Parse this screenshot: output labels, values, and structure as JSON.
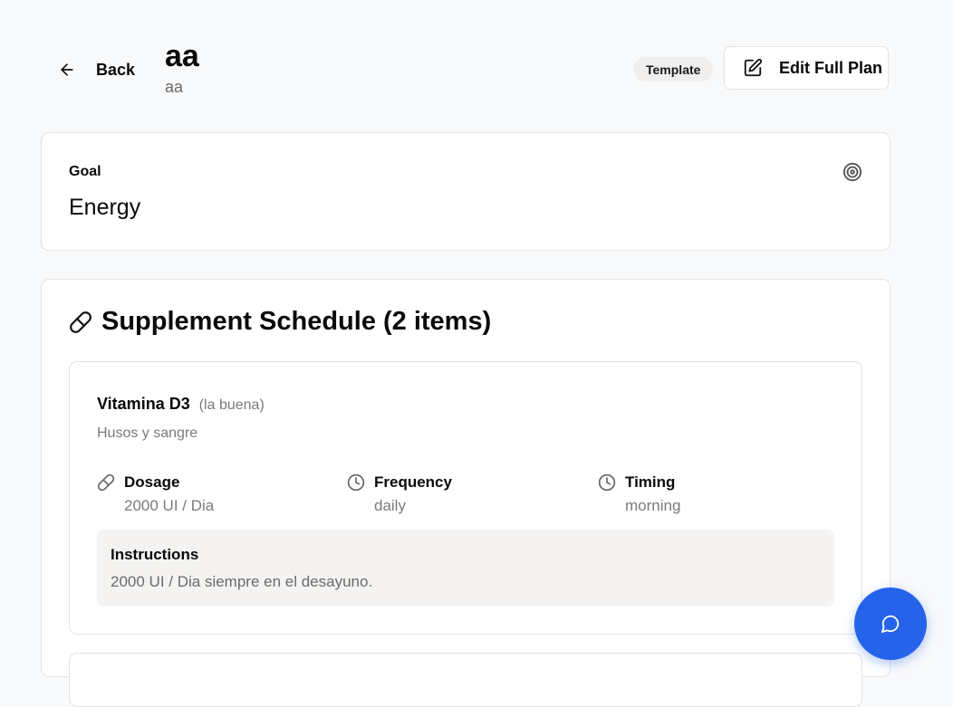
{
  "header": {
    "back_label": "Back",
    "title": "aa",
    "subtitle": "aa",
    "badge": "Template",
    "edit_label": "Edit Full Plan"
  },
  "goal": {
    "label": "Goal",
    "value": "Energy",
    "icon": "target-icon"
  },
  "schedule": {
    "title": "Supplement Schedule (2 items)",
    "icon": "pill-icon",
    "items": [
      {
        "name": "Vitamina D3",
        "alias": "(la buena)",
        "description": "Husos y sangre",
        "dosage_label": "Dosage",
        "dosage": "2000 UI / Dia",
        "frequency_label": "Frequency",
        "frequency": "daily",
        "timing_label": "Timing",
        "timing": "morning",
        "instructions_label": "Instructions",
        "instructions": "2000 UI / Dia siempre en el desayuno."
      }
    ]
  },
  "colors": {
    "accent": "#2563eb",
    "background": "#f8f9fa",
    "muted_text": "#7a7a7a"
  }
}
